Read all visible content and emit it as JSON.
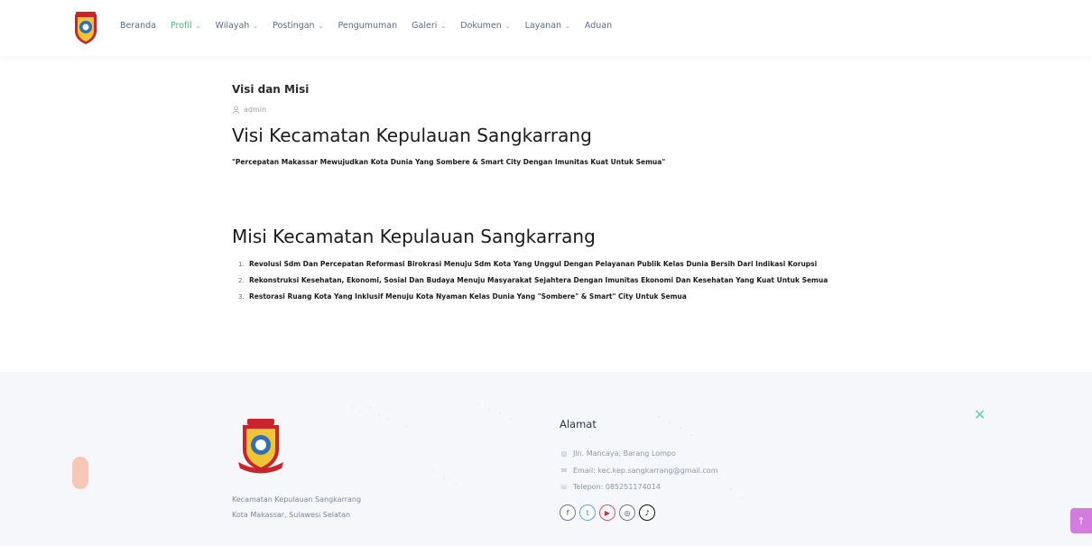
{
  "nav": {
    "items": [
      {
        "label": "Beranda",
        "has_dropdown": false,
        "active": false
      },
      {
        "label": "Profil",
        "has_dropdown": true,
        "active": true
      },
      {
        "label": "Wilayah",
        "has_dropdown": true,
        "active": false
      },
      {
        "label": "Postingan",
        "has_dropdown": true,
        "active": false
      },
      {
        "label": "Pengumuman",
        "has_dropdown": false,
        "active": false
      },
      {
        "label": "Galeri",
        "has_dropdown": true,
        "active": false
      },
      {
        "label": "Dokumen",
        "has_dropdown": true,
        "active": false
      },
      {
        "label": "Layanan",
        "has_dropdown": true,
        "active": false
      },
      {
        "label": "Aduan",
        "has_dropdown": false,
        "active": false
      }
    ]
  },
  "post": {
    "title": "Visi dan Misi",
    "author": "admin",
    "visi_heading": "Visi Kecamatan Kepulauan Sangkarrang",
    "visi_text": "\"Percepatan Makassar Mewujudkan Kota Dunia Yang Sombere & Smart City Dengan Imunitas Kuat Untuk Semua\"",
    "misi_heading": "Misi Kecamatan Kepulauan Sangkarrang",
    "misi_items": [
      {
        "num": "1.",
        "text": "Revolusi Sdm Dan Percepatan Reformasi Birokrasi Menuju Sdm Kota Yang Unggul Dengan Pelayanan Publik Kelas Dunia Bersih Dari Indikasi Korupsi"
      },
      {
        "num": "2.",
        "text": "Rekonstruksi Kesehatan, Ekonomi, Sosial Dan Budaya Menuju Masyarakat Sejahtera Dengan Imunitas Ekonomi Dan Kesehatan Yang Kuat Untuk Semua"
      },
      {
        "num": "3.",
        "text": "Restorasi Ruang Kota Yang Inklusif Menuju Kota Nyaman Kelas Dunia Yang \"Sombere\" & Smart\" City Untuk Semua"
      }
    ]
  },
  "footer": {
    "org_name": "Kecamatan Kepulauan Sangkarrang",
    "org_city": "Kota Makassar, Sulawesi Selatan",
    "address_title": "Alamat",
    "address": "Jln. Mancaya, Barang Lompo",
    "email": "Email: kec.kep.sangkarrang@gmail.com",
    "phone": "Telepon: 085251174014",
    "socials": [
      {
        "name": "facebook",
        "glyph": "f"
      },
      {
        "name": "twitter",
        "glyph": "t"
      },
      {
        "name": "youtube",
        "glyph": "▶"
      },
      {
        "name": "instagram",
        "glyph": "◎"
      },
      {
        "name": "tiktok",
        "glyph": "♪"
      }
    ]
  },
  "scroll_top": {
    "glyph": "↑"
  },
  "colors": {
    "accent_green": "#4ac17a",
    "nav_text": "#5b6b88",
    "footer_bg": "#f5f7fb",
    "scroll_button": "#d57be0"
  }
}
